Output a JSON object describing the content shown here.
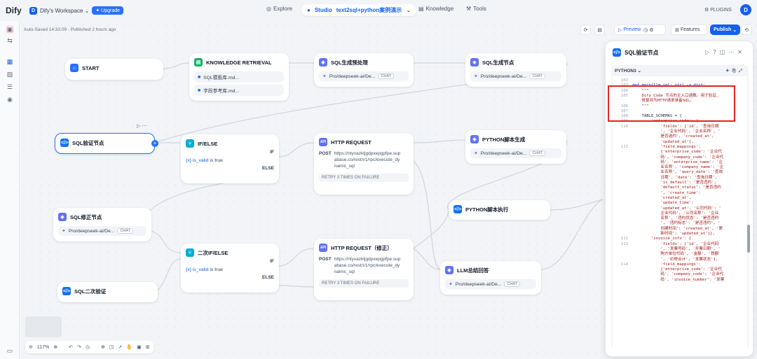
{
  "topbar": {
    "logo": "Dify",
    "workspace_initial": "D",
    "workspace": "Dify's Workspace",
    "upgrade": "Upgrade",
    "explore": "Explore",
    "studio": "Studio",
    "app_name": "text2sql+python案例演示",
    "knowledge": "Knowledge",
    "tools": "Tools",
    "plugins": "PLUGINS",
    "user_initial": "D"
  },
  "status": "Auto-Saved 14:33:09 · Published 2 hours ago",
  "actions": {
    "preview": "Preview",
    "features": "Features",
    "publish": "Publish"
  },
  "nodes": {
    "start": {
      "title": "START"
    },
    "kr": {
      "title": "KNOWLEDGE RETRIEVAL",
      "items": [
        "SQL模板库.md...",
        "字段参考库.md..."
      ]
    },
    "sqlpre": {
      "title": "SQL生成预处理",
      "model": "Pro/deepseek-ai/De...",
      "tag": "CHAT"
    },
    "sqlgen": {
      "title": "SQL生成节点",
      "model": "Pro/deepseek-ai/De...",
      "tag": "CHAT"
    },
    "sqlval": {
      "title": "SQL验证节点"
    },
    "ifelse": {
      "title": "IF/ELSE",
      "if": "IF",
      "var": "{x}",
      "cond_var": "is_valid",
      "cond_op": "is true",
      "else": "ELSE"
    },
    "http1": {
      "title": "HTTP REQUEST",
      "method": "POST",
      "url": "https://ntyvazktjgdpxepgpfpe.supabase.co/rest/v1/rpc/execute_dynamic_sql",
      "retry": "RETRY 3 TIMES ON FAILURE"
    },
    "pygen": {
      "title": "PYTHON脚本生成",
      "model": "Pro/deepseek-ai/De...",
      "tag": "CHAT"
    },
    "sqlfix": {
      "title": "SQL修正节点",
      "model": "Pro/deepseek-ai/De...",
      "tag": "CHAT"
    },
    "pyexec": {
      "title": "PYTHON脚本执行"
    },
    "ifelse2": {
      "title": "二次IF/ELSE",
      "if": "IF",
      "var": "{x}",
      "cond_var": "is_valid",
      "cond_op": "is true",
      "else": "ELSE"
    },
    "http2": {
      "title": "HTTP REQUEST（修正）",
      "method": "POST",
      "url": "https://ntyvazktjgdpxepgpfpe.supabase.co/rest/v1/rpc/execute_dynamic_sql",
      "retry": "RETRY 3 TIMES ON FAILURE"
    },
    "sql2": {
      "title": "SQL二次验证"
    },
    "llm": {
      "title": "LLM总结回答",
      "model": "Pro/deepseek-ai/De...",
      "tag": "CHAT"
    }
  },
  "panel": {
    "title": "SQL验证节点",
    "lang": "PYTHON3",
    "lines": [
      {
        "n": "102",
        "t": ""
      },
      {
        "n": "103",
        "t": "def main(llm_sql: str) -> dict:"
      },
      {
        "n": "104",
        "t": "    \"\"\""
      },
      {
        "n": "105",
        "t": "    Dify Code 节点的主入口函数。用于验证、"
      },
      {
        "n": "",
        "t": "    修复并为HTTP请求准备SQL。"
      },
      {
        "n": "106",
        "t": "    \"\"\""
      },
      {
        "n": "107",
        "t": ""
      },
      {
        "n": "108",
        "t": "    TABLE_SCHEMAS = {"
      },
      {
        "n": "109",
        "t": "        'enterprise_info': {"
      },
      {
        "n": "110",
        "t": "            'fields': ['id', '查询日期"
      },
      {
        "n": "",
        "t": "            ', '企业代码', '企业名称', '"
      },
      {
        "n": "",
        "t": "            是否选约', 'created_at',"
      },
      {
        "n": "",
        "t": "            'updated_at'],"
      },
      {
        "n": "111",
        "t": "            'field_mappings':"
      },
      {
        "n": "",
        "t": "            {'enterprise_code': '企业代"
      },
      {
        "n": "",
        "t": "            码', 'company_code': '企业代"
      },
      {
        "n": "",
        "t": "            码', 'enterprise_name': '企"
      },
      {
        "n": "",
        "t": "            业名称', 'company_name': '企"
      },
      {
        "n": "",
        "t": "            业名称', 'query_date': '查询"
      },
      {
        "n": "",
        "t": "            日期', 'date': '查询日期',"
      },
      {
        "n": "",
        "t": "            'is_default': '是否违约',"
      },
      {
        "n": "",
        "t": "            'default_status': '是否违约"
      },
      {
        "n": "",
        "t": "            ', 'create_time':"
      },
      {
        "n": "",
        "t": "            'created_at',"
      },
      {
        "n": "",
        "t": "            'update_time':"
      },
      {
        "n": "",
        "t": "            'updated_at', '公司代码': '"
      },
      {
        "n": "",
        "t": "            企业代码', '公司名称': '企业"
      },
      {
        "n": "",
        "t": "            名称', '违约状态': '是否违约"
      },
      {
        "n": "",
        "t": "            ', '违约标志': '是否违约', '"
      },
      {
        "n": "",
        "t": "            创建时间': 'created_at', '更"
      },
      {
        "n": "",
        "t": "            新时间': 'updated_at'}},"
      },
      {
        "n": "112",
        "t": "        'invoice_info': {"
      },
      {
        "n": "113",
        "t": "            'fields': ['id', '企业代码"
      },
      {
        "n": "",
        "t": "            ', '发票号码', '开票日期', '"
      },
      {
        "n": "",
        "t": "            购方单位代码', '金额', '税额"
      },
      {
        "n": "",
        "t": "            ', '价税合计', '发票状态'],"
      },
      {
        "n": "114",
        "t": "            'field_mappings':"
      },
      {
        "n": "",
        "t": "            {'enterprise_code': '企业代"
      },
      {
        "n": "",
        "t": "            码', 'company_code': '企业代"
      },
      {
        "n": "",
        "t": "            码', 'invoice_number': '发票"
      }
    ]
  },
  "zoom": "117%"
}
